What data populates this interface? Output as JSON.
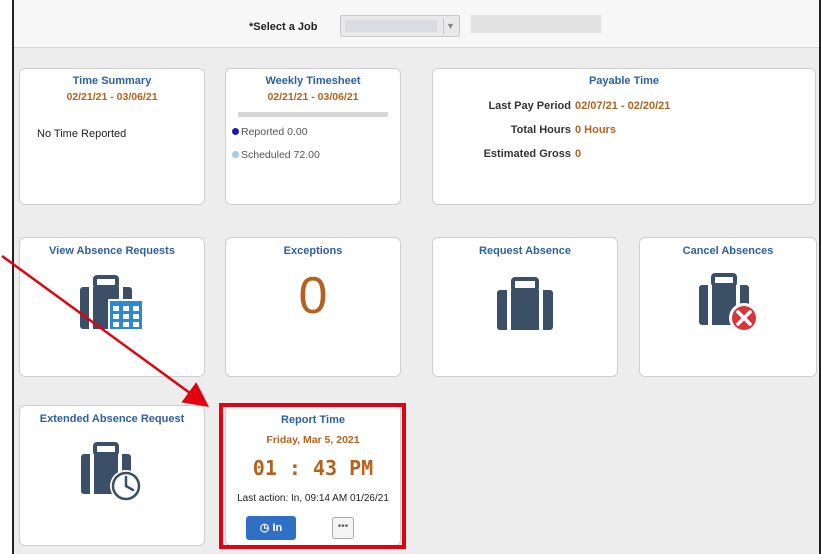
{
  "header": {
    "job_label": "*Select a Job",
    "job_value": ""
  },
  "tiles": {
    "time_summary": {
      "title": "Time Summary",
      "dates": "02/21/21 - 03/06/21",
      "message": "No Time Reported"
    },
    "weekly_timesheet": {
      "title": "Weekly Timesheet",
      "dates": "02/21/21 - 03/06/21",
      "reported": "Reported 0.00",
      "scheduled": "Scheduled 72.00",
      "reported_color": "#1a1aa6",
      "scheduled_color": "#a9c9e6"
    },
    "payable_time": {
      "title": "Payable Time",
      "rows": [
        {
          "label": "Last Pay Period",
          "value": "02/07/21 - 02/20/21"
        },
        {
          "label": "Total Hours",
          "value": "0 Hours"
        },
        {
          "label": "Estimated Gross",
          "value": "0"
        }
      ]
    },
    "view_absence": {
      "title": "View Absence Requests",
      "icon": "briefcase-calendar-icon"
    },
    "exceptions": {
      "title": "Exceptions",
      "count": "0"
    },
    "request_absence": {
      "title": "Request Absence",
      "icon": "briefcase-icon"
    },
    "cancel_absences": {
      "title": "Cancel Absences",
      "icon": "briefcase-cancel-icon"
    },
    "extended_absence": {
      "title": "Extended Absence Request",
      "icon": "briefcase-clock-icon"
    },
    "report_time": {
      "title": "Report Time",
      "date": "Friday, Mar 5, 2021",
      "time": "01 : 43 PM",
      "last_action": "Last action: In, 09:14 AM 01/26/21",
      "in_label": "In",
      "more_label": "•••"
    }
  },
  "colors": {
    "tile_title": "#2d5fa3",
    "accent_orange": "#b4621e",
    "highlight": "#e3000f",
    "icon": "#3b4f66"
  }
}
